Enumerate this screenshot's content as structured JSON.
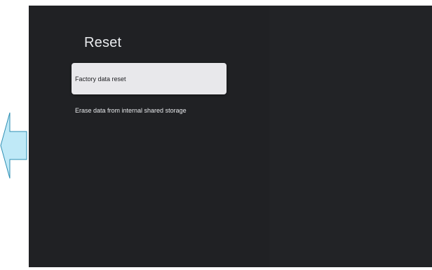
{
  "page": {
    "title": "Reset"
  },
  "menu": {
    "items": [
      {
        "label": "Factory data reset",
        "focused": true
      },
      {
        "label": "Erase data from internal shared storage",
        "focused": false
      }
    ]
  },
  "annotation": {
    "icon": "left-arrow-icon",
    "color": "#bfe9f7"
  },
  "colors": {
    "background": "#202124",
    "focused_item": "#e8e8eb",
    "text": "#e8eaed"
  }
}
